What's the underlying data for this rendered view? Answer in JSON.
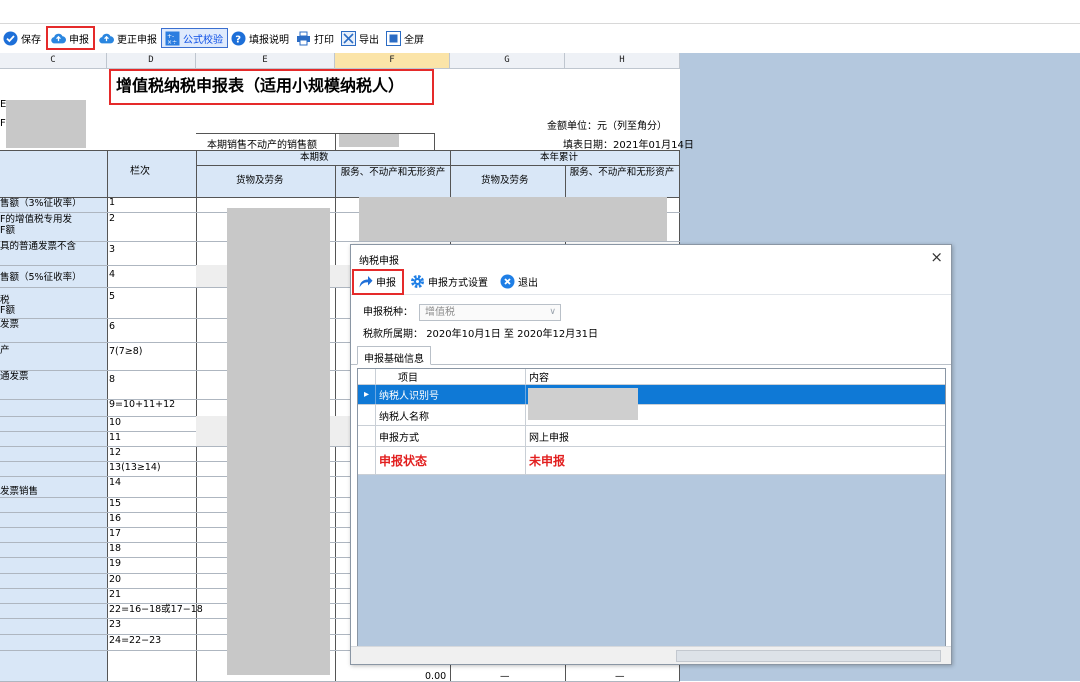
{
  "toolbar": {
    "items": [
      {
        "label": "保存",
        "icon": "check-circle-icon"
      },
      {
        "label": "申报",
        "icon": "cloud-upload-icon"
      },
      {
        "label": "更正申报",
        "icon": "cloud-upload-icon"
      },
      {
        "label": "公式校验",
        "icon": "formula-icon"
      },
      {
        "label": "填报说明",
        "icon": "help-icon"
      },
      {
        "label": "打印",
        "icon": "printer-icon"
      },
      {
        "label": "导出",
        "icon": "excel-export-icon"
      },
      {
        "label": "全屏",
        "icon": "fullscreen-icon"
      }
    ]
  },
  "sheet": {
    "columns": [
      "C",
      "D",
      "E",
      "F",
      "G",
      "H"
    ],
    "title": "增值税纳税申报表（适用小规模纳税人）",
    "unit": "金额单位：元（列至角分）",
    "fill_date": "填表日期：2021年01月14日",
    "estate_sales_label": "本期销售不动产的销售额",
    "header_lanci": "栏次",
    "header_current": "本期数",
    "header_ytd": "本年累计",
    "header_goods": "货物及劳务",
    "header_services": "服务、不动产和无形资产",
    "left_fragments": [
      "售额（3%征收率）",
      "F的增值税专用发",
      "F额",
      "具的普通发票不含",
      "售额（5%征收率）",
      "税",
      "F额",
      "发票",
      "产",
      "通发票",
      "发票销售"
    ],
    "row_codes": [
      "1",
      "2",
      "3",
      "4",
      "5",
      "6",
      "7(7≥8)",
      "8",
      "9=10+11+12",
      "10",
      "11",
      "12",
      "13(13≥14)",
      "14",
      "15",
      "16",
      "17",
      "18",
      "19",
      "20",
      "21",
      "22=16−18或17−18",
      "23",
      "24=22−23"
    ],
    "bottom_values": [
      "0.00",
      "—",
      "—"
    ]
  },
  "dialog": {
    "title": "纳税申报",
    "close_symbol": "×",
    "toolbar": [
      {
        "label": "申报",
        "icon": "share-arrow-icon"
      },
      {
        "label": "申报方式设置",
        "icon": "gear-icon"
      },
      {
        "label": "退出",
        "icon": "close-circle-icon"
      }
    ],
    "tax_type_label": "申报税种：",
    "tax_type_value": "增值税",
    "period_label": "税款所属期：",
    "period_from": "2020年10月1日",
    "period_to_word": "至",
    "period_to": "2020年12月31日",
    "tab": "申报基础信息",
    "table": {
      "headers": [
        "项目",
        "内容"
      ],
      "rows": [
        {
          "item": "纳税人识别号",
          "content": "",
          "selected": true
        },
        {
          "item": "纳税人名称",
          "content": ""
        },
        {
          "item": "申报方式",
          "content": "网上申报"
        },
        {
          "item": "申报状态",
          "content": "未申报",
          "status": true
        }
      ]
    }
  },
  "colors": {
    "highlight_red": "#e52a2a",
    "selected_row": "#0f79d6",
    "status_red": "#e21f1f",
    "sheet_background": "#b4c8de",
    "label_column": "#d9e7f7"
  }
}
